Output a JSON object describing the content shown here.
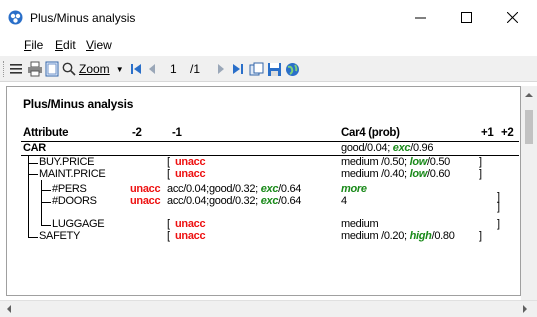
{
  "window": {
    "title": "Plus/Minus analysis",
    "minimize": "—",
    "maximize": "☐",
    "close": "✕"
  },
  "menu": {
    "file": "File",
    "edit": "Edit",
    "view": "View"
  },
  "toolbar": {
    "zoom_label": "Zoom",
    "page_current": "1",
    "page_total": "/1"
  },
  "report": {
    "title": "Plus/Minus analysis",
    "headers": {
      "attribute": "Attribute",
      "m2": "-2",
      "m1": "-1",
      "value": "Car4 (prob)",
      "p1": "+1",
      "p2": "+2"
    },
    "rows": [
      {
        "attr": "CAR",
        "minus1": "",
        "value": "good/0.04; ",
        "value_em": "exc",
        "value_tail": "/0.96",
        "plus": ""
      },
      {
        "attr": "BUY.PRICE",
        "minus1": "unacc",
        "value": "medium /0.50; ",
        "value_em": "low",
        "value_tail": "/0.50",
        "plus": ""
      },
      {
        "attr": "MAINT.PRICE",
        "minus1": "unacc",
        "value": "medium /0.40; ",
        "value_em": "low",
        "value_tail": "/0.60",
        "plus": ""
      },
      {
        "attr": "#PERS",
        "minus2": "unacc",
        "minus1": "acc/0.04;good/0.32; ",
        "minus1_em": "exc",
        "minus1_tail": "/0.64",
        "plus": "more"
      },
      {
        "attr": "#DOORS",
        "minus2": "unacc",
        "minus1": "acc/0.04;good/0.32; ",
        "minus1_em": "exc",
        "minus1_tail": "/0.64",
        "plus": "4"
      },
      {
        "attr": "LUGGAGE",
        "minus1": "unacc",
        "value": "medium",
        "plus": ""
      },
      {
        "attr": "SAFETY",
        "minus1": "unacc",
        "value": "medium /0.20; ",
        "value_em": "high",
        "value_tail": "/0.80",
        "plus": ""
      }
    ]
  }
}
